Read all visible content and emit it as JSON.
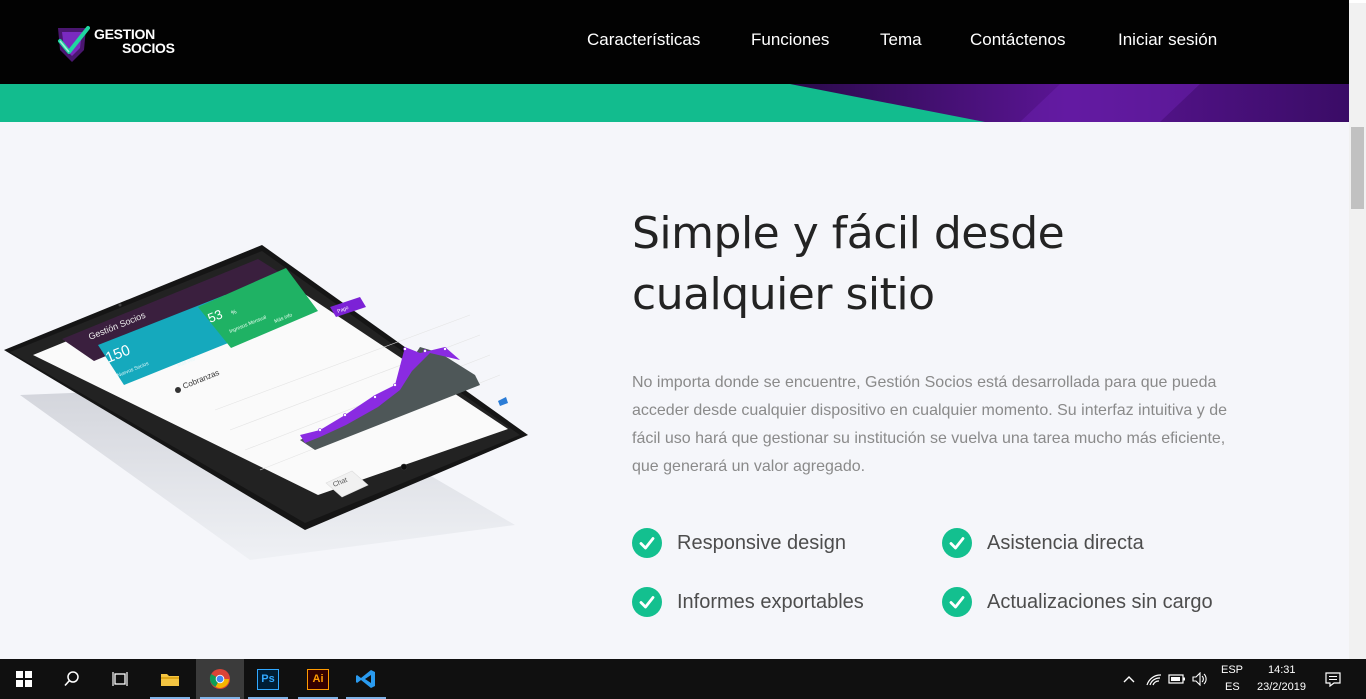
{
  "brand": {
    "line1": "GESTION",
    "line2": "SOCIOS"
  },
  "nav": [
    {
      "label": "Características"
    },
    {
      "label": "Funciones"
    },
    {
      "label": "Tema"
    },
    {
      "label": "Contáctenos"
    },
    {
      "label": "Iniciar sesión"
    }
  ],
  "hero": {
    "title_line1": "Simple y fácil desde",
    "title_line2": "cualquier sitio",
    "description": "No importa donde se encuentre, Gestión Socios está desarrollada para que pueda acceder desde cualquier dispositivo en cualquier momento. Su interfaz intuitiva y de fácil uso hará que gestionar su institución se vuelva una tarea mucho más eficiente, que generará un valor agregado."
  },
  "features": [
    {
      "label": "Responsive design"
    },
    {
      "label": "Asistencia directa"
    },
    {
      "label": "Informes exportables"
    },
    {
      "label": "Actualizaciones sin cargo"
    }
  ],
  "device_screen": {
    "app_title": "Gestión Socios",
    "card1_value": "150",
    "card1_label": "Nuevos Socios",
    "card1_link": "Más info",
    "card2_value": "53",
    "card2_unit": "%",
    "card2_label": "Ingresos Mensual",
    "card2_link": "Más info",
    "chart_title": "Cobranzas",
    "button_label": "Pago",
    "tab_label": "Chat"
  },
  "taskbar": {
    "apps": [
      {
        "icon": "windows-start-icon"
      },
      {
        "icon": "search-icon"
      },
      {
        "icon": "task-view-icon"
      },
      {
        "icon": "file-explorer-icon"
      },
      {
        "icon": "chrome-icon"
      },
      {
        "icon": "photoshop-icon",
        "label": "Ps"
      },
      {
        "icon": "illustrator-icon",
        "label": "Ai"
      },
      {
        "icon": "vscode-icon"
      }
    ],
    "lang_top": "ESP",
    "lang_bottom": "ES",
    "time": "14:31",
    "date": "23/2/2019"
  },
  "colors": {
    "accent_green": "#13c08f",
    "band_green": "#12bc8e",
    "purple": "#6a1ab0",
    "header_bg": "#020202"
  }
}
